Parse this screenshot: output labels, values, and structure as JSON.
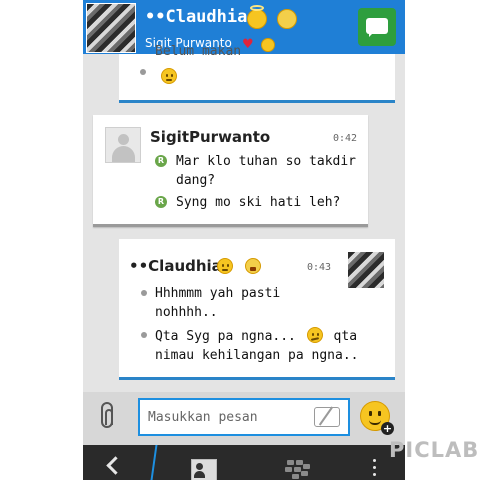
{
  "header": {
    "contact_name": "••Claudhia",
    "contact_status": "Sigit Purwanto"
  },
  "messages": [
    {
      "direction": "outgoing",
      "partial": true,
      "cut_text": "Belum makan",
      "items": [
        {
          "type": "emoji",
          "icon": "emoji-face-icon"
        }
      ]
    },
    {
      "direction": "incoming",
      "sender": "SigitPurwanto",
      "time": "0:42",
      "items": [
        {
          "text": "Mar klo tuhan so takdir dang?",
          "receipt": "R"
        },
        {
          "text": "Syng mo ski hati leh?",
          "receipt": "R"
        }
      ]
    },
    {
      "direction": "outgoing",
      "sender": "••Claudhia",
      "time": "0:43",
      "items": [
        {
          "text": "Hhhmmm yah pasti nohhhh.."
        },
        {
          "text_before": "Qta Syg pa ngna...",
          "emoji": "embarrassed-face-icon",
          "text_after": "qta nimau kehilangan pa ngna.."
        }
      ]
    }
  ],
  "composer": {
    "placeholder": "Masukkan pesan"
  },
  "watermark": "PICLAB",
  "colors": {
    "header_bg": "#1f7fd6",
    "accent_blue": "#2a84c8",
    "chat_button": "#2e9e3e",
    "read_receipt": "#6aa64a",
    "emoji_yellow": "#f6c521"
  }
}
